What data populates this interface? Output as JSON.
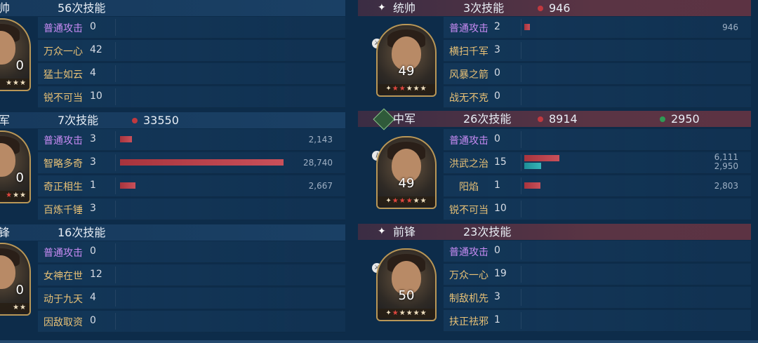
{
  "left": {
    "sections": [
      {
        "role": "帅",
        "skill_count": "56次技能",
        "damage_red": "",
        "portrait_level": "0",
        "skills": [
          {
            "name": "普通攻击",
            "count": "0",
            "value": "",
            "bar": 0,
            "normal": true
          },
          {
            "name": "万众一心",
            "count": "42",
            "value": "",
            "bar": 0
          },
          {
            "name": "猛士如云",
            "count": "4",
            "value": "",
            "bar": 0
          },
          {
            "name": "锐不可当",
            "count": "10",
            "value": "",
            "bar": 0
          }
        ]
      },
      {
        "role": "军",
        "skill_count": "7次技能",
        "damage_red": "33550",
        "portrait_level": "0",
        "skills": [
          {
            "name": "普通攻击",
            "count": "3",
            "value": "2,143",
            "bar": 0.0746,
            "normal": true
          },
          {
            "name": "智略多奇",
            "count": "3",
            "value": "28,740",
            "bar": 1.0
          },
          {
            "name": "奇正相生",
            "count": "1",
            "value": "2,667",
            "bar": 0.0928
          },
          {
            "name": "百炼千锤",
            "count": "3",
            "value": "",
            "bar": 0
          }
        ]
      },
      {
        "role": "锋",
        "skill_count": "16次技能",
        "damage_red": "",
        "portrait_level": "0",
        "skills": [
          {
            "name": "普通攻击",
            "count": "0",
            "value": "",
            "bar": 0,
            "normal": true
          },
          {
            "name": "女神在世",
            "count": "12",
            "value": "",
            "bar": 0
          },
          {
            "name": "动于九天",
            "count": "4",
            "value": "",
            "bar": 0
          },
          {
            "name": "因敌取资",
            "count": "0",
            "value": "",
            "bar": 0
          }
        ]
      }
    ]
  },
  "right": {
    "sections": [
      {
        "role": "统帅",
        "skill_count": "3次技能",
        "damage_red": "946",
        "damage_green": "",
        "portrait_level": "49",
        "stars_red": 2,
        "skills": [
          {
            "name": "普通攻击",
            "count": "2",
            "value": "946",
            "bar": 0.155,
            "normal": true
          },
          {
            "name": "横扫千军",
            "count": "3",
            "value": "",
            "bar": 0
          },
          {
            "name": "风暴之箭",
            "count": "0",
            "value": "",
            "bar": 0
          },
          {
            "name": "战无不克",
            "count": "0",
            "value": "",
            "bar": 0
          }
        ]
      },
      {
        "role": "中军",
        "skill_count": "26次技能",
        "damage_red": "8914",
        "damage_green": "2950",
        "portrait_level": "49",
        "stars_red": 3,
        "skills": [
          {
            "name": "普通攻击",
            "count": "0",
            "value": "",
            "bar": 0,
            "normal": true
          },
          {
            "name": "洪武之治",
            "count": "15",
            "value": "6,111",
            "value2": "2,950",
            "bar": 1.0,
            "bar2": 0.483
          },
          {
            "name": "阳焰",
            "count": "1",
            "value": "2,803",
            "bar": 0.459
          },
          {
            "name": "锐不可当",
            "count": "10",
            "value": "",
            "bar": 0
          }
        ]
      },
      {
        "role": "前锋",
        "skill_count": "23次技能",
        "damage_red": "",
        "damage_green": "",
        "portrait_level": "50",
        "stars_red": 1,
        "skills": [
          {
            "name": "普通攻击",
            "count": "0",
            "value": "",
            "bar": 0,
            "normal": true
          },
          {
            "name": "万众一心",
            "count": "19",
            "value": "",
            "bar": 0
          },
          {
            "name": "制敌机先",
            "count": "3",
            "value": "",
            "bar": 0
          },
          {
            "name": "扶正祛邪",
            "count": "1",
            "value": "",
            "bar": 0
          }
        ]
      }
    ]
  },
  "colors": {
    "damage_red": "#c0393f",
    "damage_green": "#2f9b55",
    "normal_attack": "#c98cf5",
    "skill_name": "#e8c176"
  },
  "icons": {
    "sparkle": "✦",
    "star": "★"
  }
}
